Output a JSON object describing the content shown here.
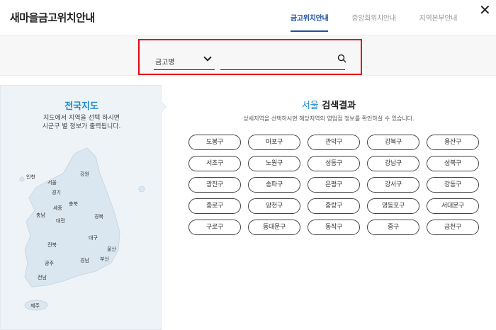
{
  "header": {
    "title": "새마을금고위치안내",
    "tabs": [
      {
        "label": "금고위치안내",
        "active": true
      },
      {
        "label": "중앙회위치안내",
        "active": false
      },
      {
        "label": "지역본부안내",
        "active": false
      }
    ],
    "close_icon": "close-icon"
  },
  "search": {
    "select_value": "금고명",
    "input_value": "",
    "input_placeholder": "",
    "icon": "search-icon",
    "highlight_color": "#e30613"
  },
  "map_panel": {
    "title": "전국지도",
    "desc_line1": "지도에서 지역을 선택 하시면",
    "desc_line2": "시군구 별 정보가 출력됩니다.",
    "regions": {
      "incheon": "인천",
      "seoul": "서울",
      "gangwon": "강원",
      "gyeonggi": "경기",
      "sejong": "세종",
      "chungbuk": "충북",
      "chungnam": "충남",
      "daejeon": "대전",
      "gyeongbuk": "경북",
      "daegu": "대구",
      "jeonbuk": "전북",
      "ulsan": "울산",
      "gwangju": "광주",
      "gyeongnam": "경남",
      "busan": "부산",
      "jeonnam": "전남",
      "jeju": "제주"
    }
  },
  "results": {
    "city": "서울",
    "title_suffix": "검색결과",
    "desc": "상세지역을 선택하시면 해당지역의 영업점 정보를 확인하실 수 있습니다.",
    "districts": [
      "도봉구",
      "마포구",
      "관악구",
      "강북구",
      "용산구",
      "서초구",
      "노원구",
      "성동구",
      "강남구",
      "성북구",
      "광진구",
      "송파구",
      "은평구",
      "강서구",
      "강동구",
      "종로구",
      "양천구",
      "중랑구",
      "영등포구",
      "서대문구",
      "구로구",
      "동대문구",
      "동작구",
      "중구",
      "금천구"
    ]
  },
  "colors": {
    "accent_blue": "#1a8bcb",
    "tab_active": "#1f4fa3",
    "panel_bg": "#eef3f7",
    "map_fill": "#dbe7f0"
  }
}
